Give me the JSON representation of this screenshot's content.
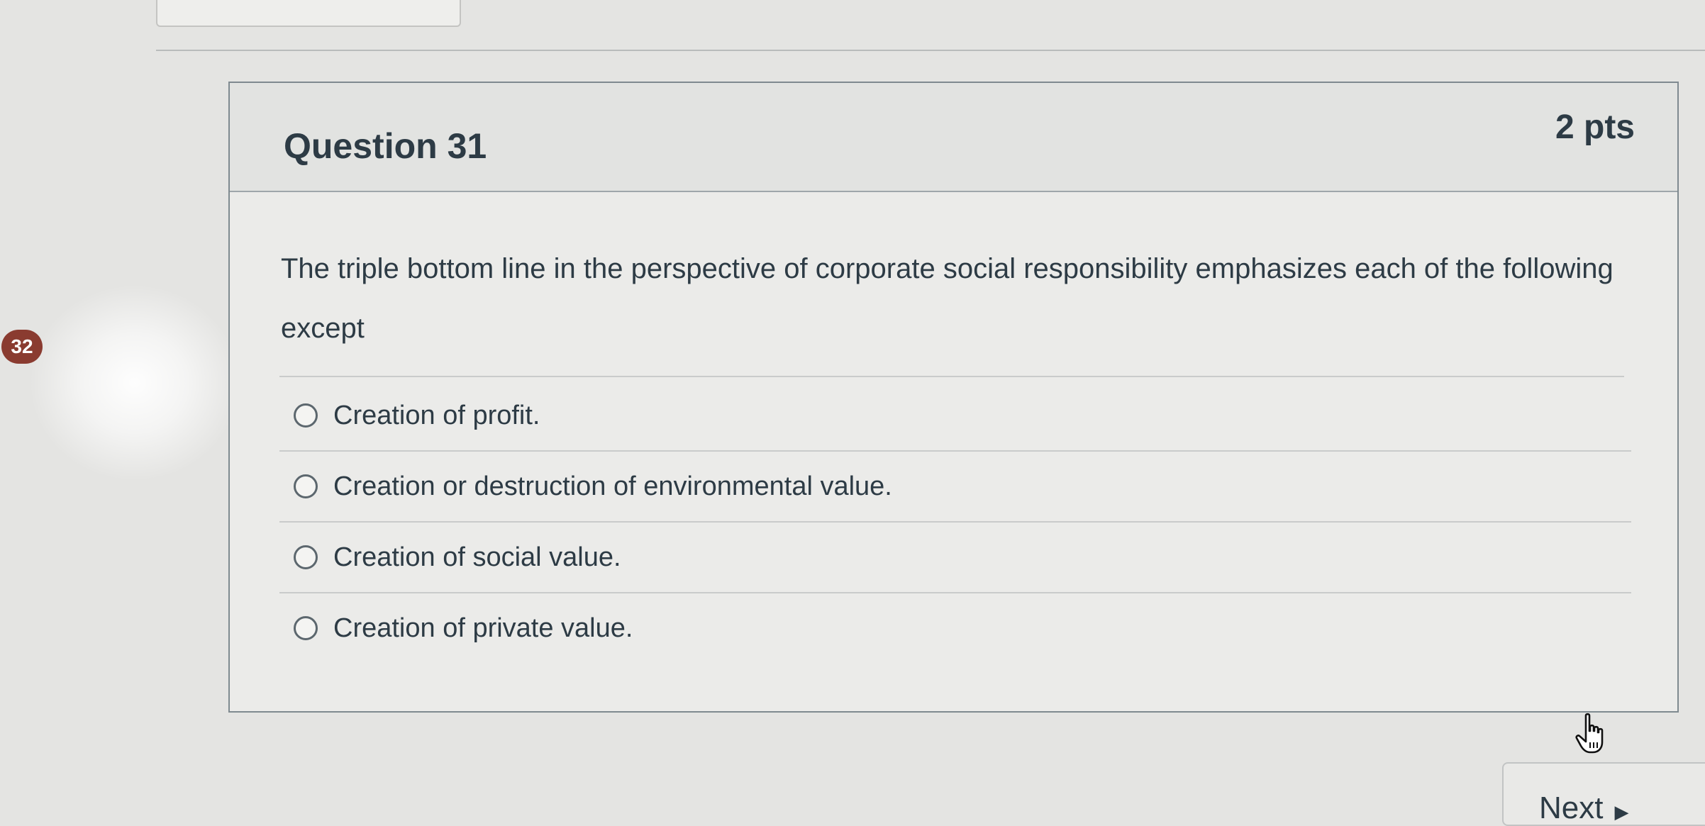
{
  "page": {
    "background": "#e4e4e2",
    "accent": "#2d3b45",
    "badge_color": "#8a3b30"
  },
  "sidebar": {
    "question_badge": "32"
  },
  "question": {
    "title": "Question 31",
    "points": "2 pts",
    "text": "The triple bottom line in the perspective of corporate social responsibility emphasizes each of the following except",
    "answers": [
      {
        "label": "Creation of profit.",
        "selected": false
      },
      {
        "label": "Creation or destruction of environmental value.",
        "selected": false
      },
      {
        "label": "Creation of social value.",
        "selected": false
      },
      {
        "label": "Creation of private value.",
        "selected": false
      }
    ]
  },
  "navigation": {
    "next_label": "Next",
    "next_icon": "triangle-right-icon"
  },
  "cursor": {
    "icon": "hand-pointer-icon"
  }
}
